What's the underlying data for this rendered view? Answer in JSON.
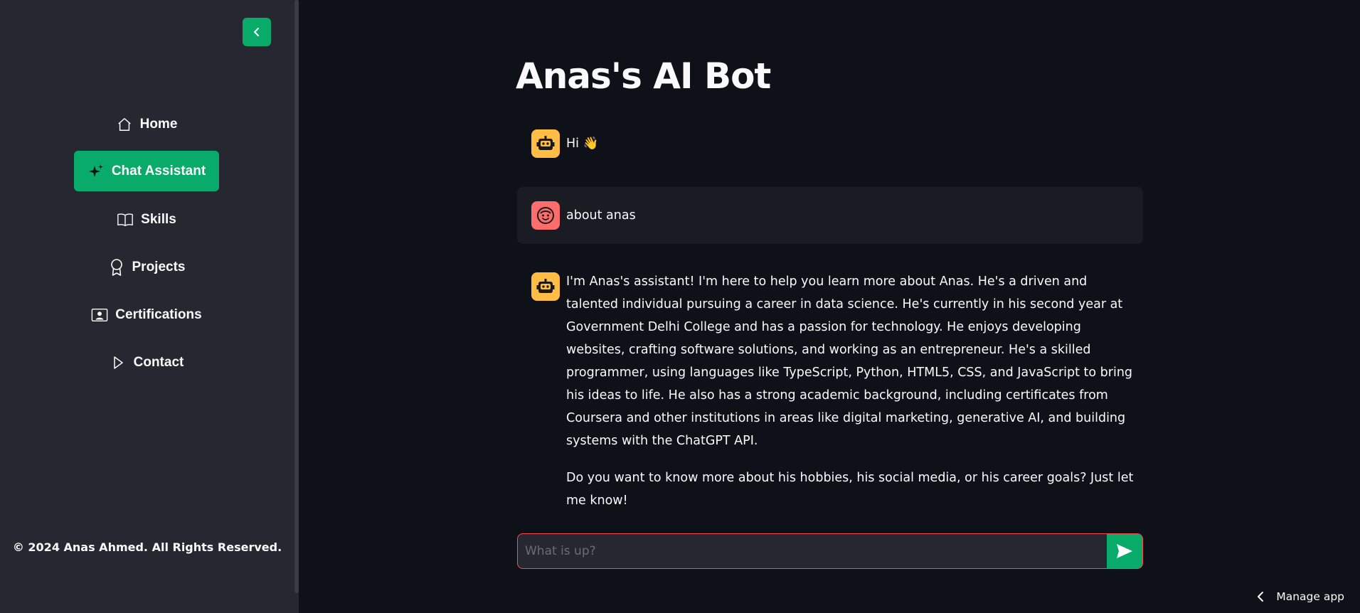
{
  "sidebar": {
    "collapse_icon": "chevron-left-icon",
    "nav_items": [
      {
        "label": "Home",
        "icon": "house-icon",
        "active": false
      },
      {
        "label": "Chat Assistant",
        "icon": "sparkles-icon",
        "active": true
      },
      {
        "label": "Skills",
        "icon": "book-icon",
        "active": false
      },
      {
        "label": "Projects",
        "icon": "award-icon",
        "active": false
      },
      {
        "label": "Certifications",
        "icon": "person-card-icon",
        "active": false
      },
      {
        "label": "Contact",
        "icon": "play-outline-icon",
        "active": false
      }
    ],
    "footer": "© 2024 Anas Ahmed. All Rights Reserved."
  },
  "main": {
    "title": "Anas's AI Bot",
    "messages": [
      {
        "role": "assistant",
        "avatar": "robot-face-icon",
        "text": "Hi 👋"
      },
      {
        "role": "user",
        "avatar": "smile-face-icon",
        "text": "about anas"
      },
      {
        "role": "assistant",
        "avatar": "robot-face-icon",
        "paragraphs": [
          "I'm Anas's assistant! I'm here to help you learn more about Anas. He's a driven and talented individual pursuing a career in data science. He's currently in his second year at Government Delhi College and has a passion for technology. He enjoys developing websites, crafting software solutions, and working as an entrepreneur. He's a skilled programmer, using languages like TypeScript, Python, HTML5, CSS, and JavaScript to bring his ideas to life. He also has a strong academic background, including certificates from Coursera and other institutions in areas like digital marketing, generative AI, and building systems with the ChatGPT API.",
          "Do you want to know more about his hobbies, his social media, or his career goals? Just let me know!"
        ]
      }
    ],
    "chat_input": {
      "value": "",
      "placeholder": "What is up?",
      "send_icon": "send-arrow-icon"
    }
  },
  "manage_app": {
    "label": "Manage app",
    "icon": "chevron-left-icon"
  },
  "colors": {
    "background": "#0e1117",
    "sidebar": "#262730",
    "accent": "#09ab6b",
    "bot_avatar": "#ffbd45",
    "user_avatar": "#ff6c6c",
    "input_border": "#ff4b4b"
  }
}
